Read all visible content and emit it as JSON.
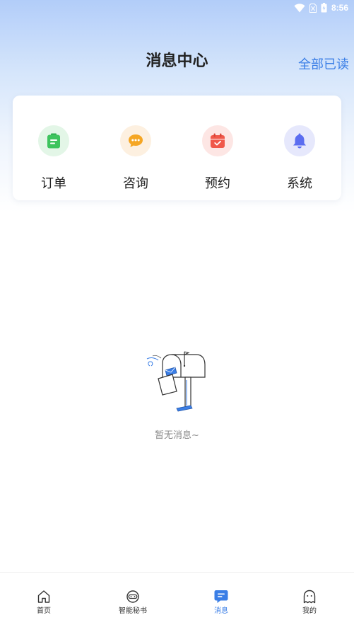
{
  "status_bar": {
    "time": "8:56"
  },
  "header": {
    "title": "消息中心",
    "mark_all_read": "全部已读"
  },
  "categories": [
    {
      "label": "订单",
      "icon": "order-icon",
      "color": "#3ec45e",
      "bg": "#e3f6e7"
    },
    {
      "label": "咨询",
      "icon": "chat-bubble-icon",
      "color": "#f5a623",
      "bg": "#fdf0e0"
    },
    {
      "label": "预约",
      "icon": "calendar-icon",
      "color": "#f0584a",
      "bg": "#fde6e4"
    },
    {
      "label": "系统",
      "icon": "bell-icon",
      "color": "#5b6df0",
      "bg": "#e6e8fc"
    }
  ],
  "empty_state": {
    "text": "暂无消息~"
  },
  "bottom_nav": {
    "items": [
      {
        "label": "首页",
        "icon": "home-icon",
        "active": false
      },
      {
        "label": "智能秘书",
        "icon": "assistant-icon",
        "active": false
      },
      {
        "label": "消息",
        "icon": "message-icon",
        "active": true
      },
      {
        "label": "我的",
        "icon": "profile-icon",
        "active": false
      }
    ],
    "active_color": "#3a7ee6"
  }
}
